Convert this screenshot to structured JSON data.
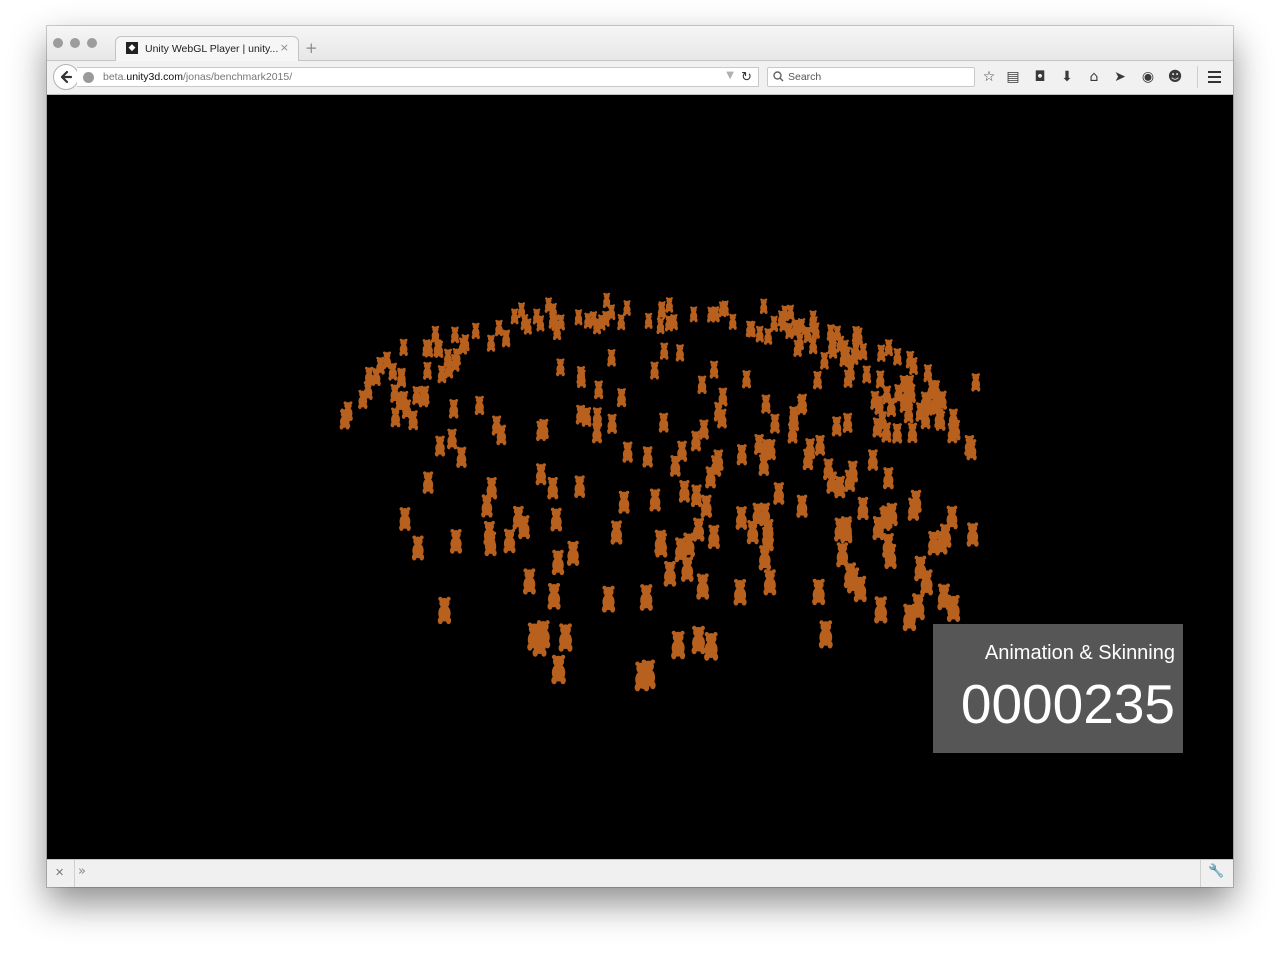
{
  "browser": {
    "tab": {
      "title": "Unity WebGL Player | unity...",
      "favicon_icon": "unity-logo-icon",
      "close_glyph": "×"
    },
    "new_tab_glyph": "+",
    "url": {
      "prefix": "beta.",
      "domain": "unity3d.com",
      "path": "/jonas/benchmark2015/"
    },
    "search": {
      "placeholder": "Search"
    },
    "toolbar_icons": [
      "bookmark-star-icon",
      "reading-list-icon",
      "pocket-icon",
      "downloads-icon",
      "home-icon",
      "send-icon",
      "extension-icon",
      "chat-icon",
      "menu-icon"
    ]
  },
  "benchmark": {
    "title": "Animation & Skinning",
    "count": "0000235"
  },
  "colors": {
    "canvas_bg": "#000000",
    "bear": "#b8611f",
    "overlay_bg": "#5c5c5c"
  }
}
